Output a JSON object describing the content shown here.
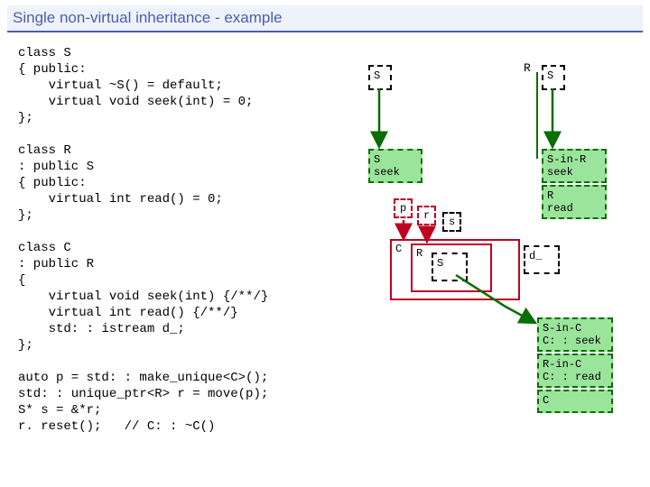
{
  "title": "Single non-virtual inheritance - example",
  "code": "class S\n{ public:\n    virtual ~S() = default;\n    virtual void seek(int) = 0;\n};\n\nclass R\n: public S\n{ public:\n    virtual int read() = 0;\n};\n\nclass C\n: public R\n{\n    virtual void seek(int) {/**/}\n    virtual int read() {/**/}\n    std: : istream d_;\n};\n\nauto p = std: : make_unique<C>();\nstd: : unique_ptr<R> r = move(p);\nS* s = &*r;\nr. reset();   // C: : ~C()",
  "diagram": {
    "S_label": "S",
    "R_label": "R",
    "S_right": "S",
    "S_vtbl_line1": "S",
    "S_vtbl_line2": "seek",
    "R_vtbl_line1": "S-in-R",
    "R_vtbl_line2": "seek",
    "R_vtbl_line3": "R",
    "R_vtbl_line4": "read",
    "p": "p",
    "r": "r",
    "s": "s",
    "C": "C",
    "R_cell": "R",
    "S_cell": "S",
    "d_cell": "d_",
    "C_vtbl_line1": "S-in-C",
    "C_vtbl_line2": "C: : seek",
    "C_vtbl_line3": "R-in-C",
    "C_vtbl_line4": "C: : read",
    "C_vtbl_line5": "C"
  }
}
